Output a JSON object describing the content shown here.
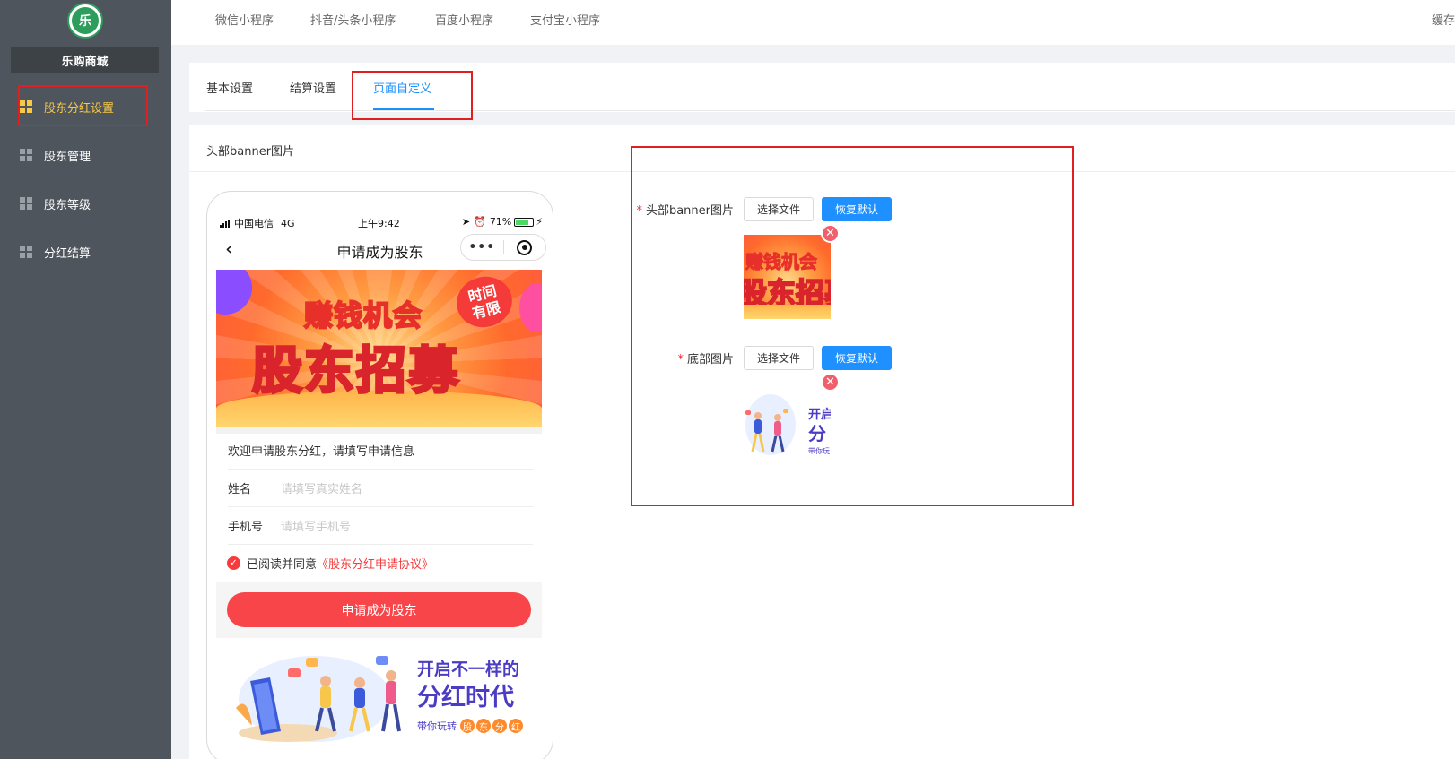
{
  "sidebar": {
    "logo_text": "乐",
    "shop_name": "乐购商城",
    "items": [
      {
        "label": "股东分红设置"
      },
      {
        "label": "股东管理"
      },
      {
        "label": "股东等级"
      },
      {
        "label": "分红结算"
      }
    ]
  },
  "topnav": {
    "items": [
      {
        "label": "微信小程序"
      },
      {
        "label": "抖音/头条小程序"
      },
      {
        "label": "百度小程序"
      },
      {
        "label": "支付宝小程序"
      }
    ],
    "right_label": "缓存"
  },
  "tabs": [
    {
      "label": "基本设置"
    },
    {
      "label": "结算设置"
    },
    {
      "label": "页面自定义"
    }
  ],
  "section_title": "头部banner图片",
  "phone": {
    "carrier": "中国电信",
    "network": "4G",
    "time": "上午9:42",
    "battery": "71%",
    "nav_title": "申请成为股东",
    "back_icon": "‹",
    "more_icon": "•••",
    "banner": {
      "subtitle": "赚钱机会",
      "title": "股东招募",
      "badge_line1": "时间",
      "badge_line2": "有限"
    },
    "welcome": "欢迎申请股东分红，请填写申请信息",
    "fields": [
      {
        "label": "姓名",
        "placeholder": "请填写真实姓名"
      },
      {
        "label": "手机号",
        "placeholder": "请填写手机号"
      }
    ],
    "agree_text": "已阅读并同意",
    "agree_link": "《股东分红申请协议》",
    "apply_button": "申请成为股东",
    "footer": {
      "line1": "开启不一样的",
      "line2": "分红时代",
      "line3": "带你玩转",
      "chips": [
        "股",
        "东",
        "分",
        "红"
      ]
    }
  },
  "uploads": [
    {
      "label": "头部banner图片",
      "choose_label": "选择文件",
      "reset_label": "恢复默认",
      "thumb_text1": "赚钱机会",
      "thumb_text2": "股东招募"
    },
    {
      "label": "底部图片",
      "choose_label": "选择文件",
      "reset_label": "恢复默认",
      "thumb_text1": "开启",
      "thumb_text2": "分",
      "thumb_text3": "带你玩"
    }
  ],
  "colors": {
    "sidebar_bg": "#4f555c",
    "active_accent": "#f7c948",
    "primary": "#1890ff",
    "danger": "#f53b3b",
    "highlight_box": "#e02020"
  }
}
